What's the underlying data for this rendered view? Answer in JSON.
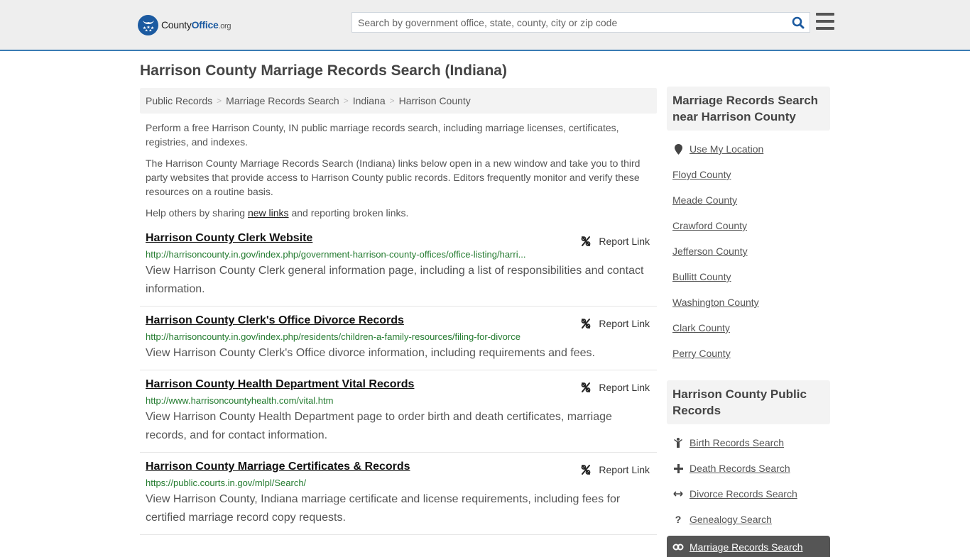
{
  "header": {
    "logo": {
      "county": "County",
      "office": "Office",
      "org": ".org"
    },
    "search": {
      "placeholder": "Search by government office, state, county, city or zip code",
      "value": ""
    },
    "search_icon": "search-icon",
    "menu_icon": "hamburger-menu-icon"
  },
  "page": {
    "title": "Harrison County Marriage Records Search (Indiana)"
  },
  "breadcrumb": [
    {
      "label": "Public Records"
    },
    {
      "label": "Marriage Records Search"
    },
    {
      "label": "Indiana"
    },
    {
      "label": "Harrison County"
    }
  ],
  "intro": {
    "p1": "Perform a free Harrison County, IN public marriage records search, including marriage licenses, certificates, registries, and indexes.",
    "p2": "The Harrison County Marriage Records Search (Indiana) links below open in a new window and take you to third party websites that provide access to Harrison County public records. Editors frequently monitor and verify these resources on a routine basis.",
    "p3_before": "Help others by sharing ",
    "p3_link": "new links",
    "p3_after": " and reporting broken links."
  },
  "results": [
    {
      "title": "Harrison County Clerk Website",
      "url": "http://harrisoncounty.in.gov/index.php/government-harrison-county-offices/office-listing/harri...",
      "description": "View Harrison County Clerk general information page, including a list of responsibilities and contact information.",
      "report_label": "Report Link"
    },
    {
      "title": "Harrison County Clerk's Office Divorce Records",
      "url": "http://harrisoncounty.in.gov/index.php/residents/children-a-family-resources/filing-for-divorce",
      "description": "View Harrison County Clerk's Office divorce information, including requirements and fees.",
      "report_label": "Report Link"
    },
    {
      "title": "Harrison County Health Department Vital Records",
      "url": "http://www.harrisoncountyhealth.com/vital.htm",
      "description": "View Harrison County Health Department page to order birth and death certificates, marriage records, and for contact information.",
      "report_label": "Report Link"
    },
    {
      "title": "Harrison County Marriage Certificates & Records",
      "url": "https://public.courts.in.gov/mlpl/Search/",
      "description": "View Harrison County, Indiana marriage certificate and license requirements, including fees for certified marriage record copy requests.",
      "report_label": "Report Link"
    }
  ],
  "sidebar": {
    "nearby": {
      "heading": "Marriage Records Search near Harrison County",
      "use_location": "Use My Location",
      "counties": [
        "Floyd County",
        "Meade County",
        "Crawford County",
        "Jefferson County",
        "Bullitt County",
        "Washington County",
        "Clark County",
        "Perry County"
      ]
    },
    "public_records": {
      "heading": "Harrison County Public Records",
      "items": [
        {
          "label": "Birth Records Search",
          "icon": "child-icon"
        },
        {
          "label": "Death Records Search",
          "icon": "plus-icon"
        },
        {
          "label": "Divorce Records Search",
          "icon": "arrows-horizontal-icon"
        },
        {
          "label": "Genealogy Search",
          "icon": "question-icon"
        }
      ],
      "active": {
        "label": "Marriage Records Search",
        "icon": "rings-icon"
      }
    }
  },
  "colors": {
    "brand": "#1b5aa0",
    "header_border": "#3a7cb4",
    "url_green": "#237b2f",
    "active_bg": "#555555"
  }
}
